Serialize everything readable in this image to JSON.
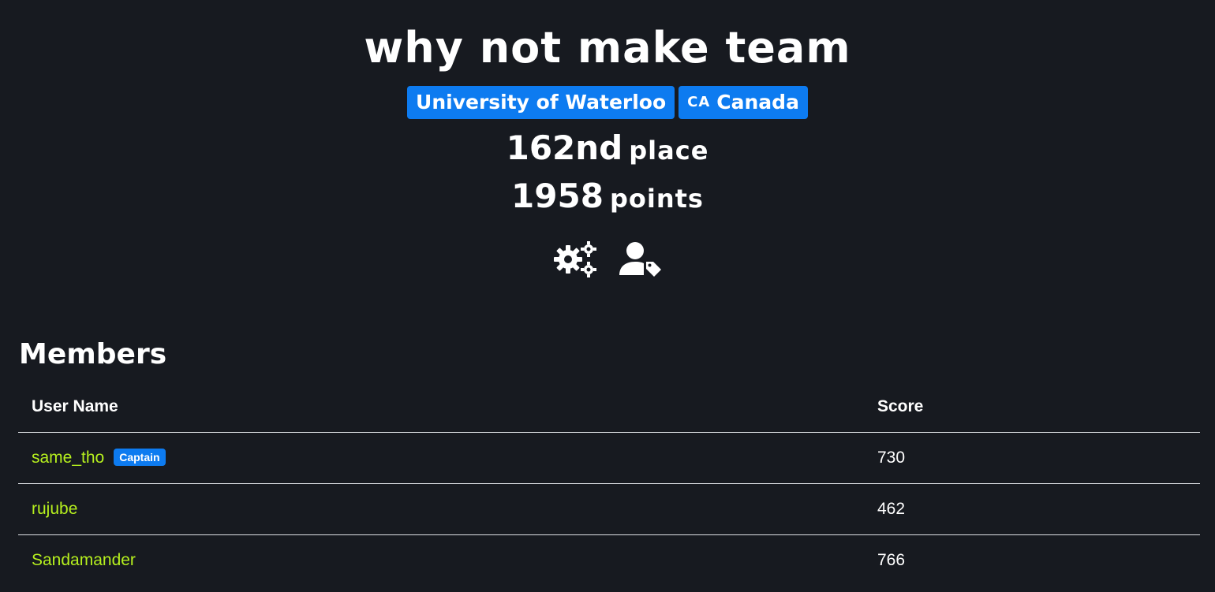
{
  "team": {
    "name": "why not make team",
    "affiliation": "University of Waterloo",
    "country_code": "CA",
    "country_name": "Canada",
    "place_value": "162nd",
    "place_label": "place",
    "points_value": "1958",
    "points_label": "points"
  },
  "icons": {
    "settings": "gears-icon",
    "captain": "user-tag-icon"
  },
  "members": {
    "title": "Members",
    "columns": [
      "User Name",
      "Score"
    ],
    "rows": [
      {
        "name": "same_tho",
        "badge": "Captain",
        "score": "730"
      },
      {
        "name": "rujube",
        "badge": "",
        "score": "462"
      },
      {
        "name": "Sandamander",
        "badge": "",
        "score": "766"
      }
    ]
  },
  "colors": {
    "background": "#171a20",
    "badge": "#0d7bf0",
    "user_link": "#b6f01e",
    "text": "#ffffff"
  }
}
